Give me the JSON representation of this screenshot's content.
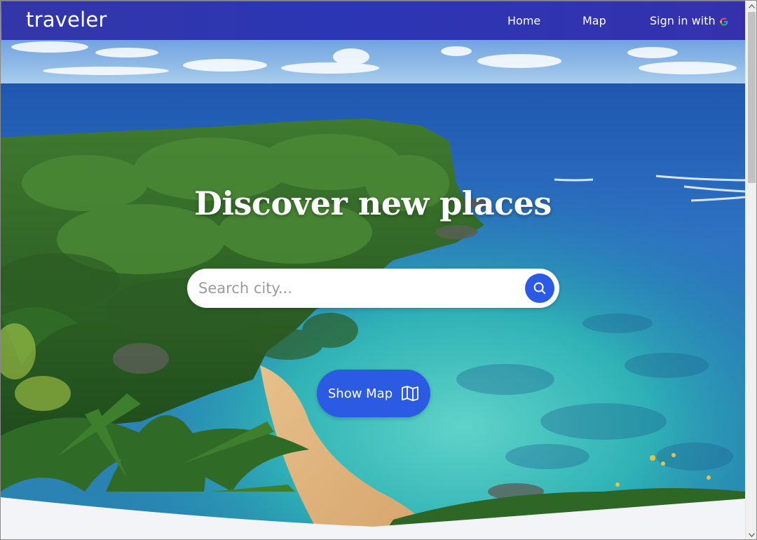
{
  "brand": {
    "name": "traveler"
  },
  "nav": {
    "home": "Home",
    "map": "Map",
    "signin": "Sign in with"
  },
  "hero": {
    "headline": "Discover new places",
    "search_placeholder": "Search city...",
    "show_map_label": "Show Map"
  },
  "icons": {
    "search": "search-icon",
    "map": "map-icon",
    "google": "google-icon"
  },
  "colors": {
    "navbar": "#2f35b0",
    "accent": "#2b5be3",
    "text_light": "#ffffff"
  }
}
